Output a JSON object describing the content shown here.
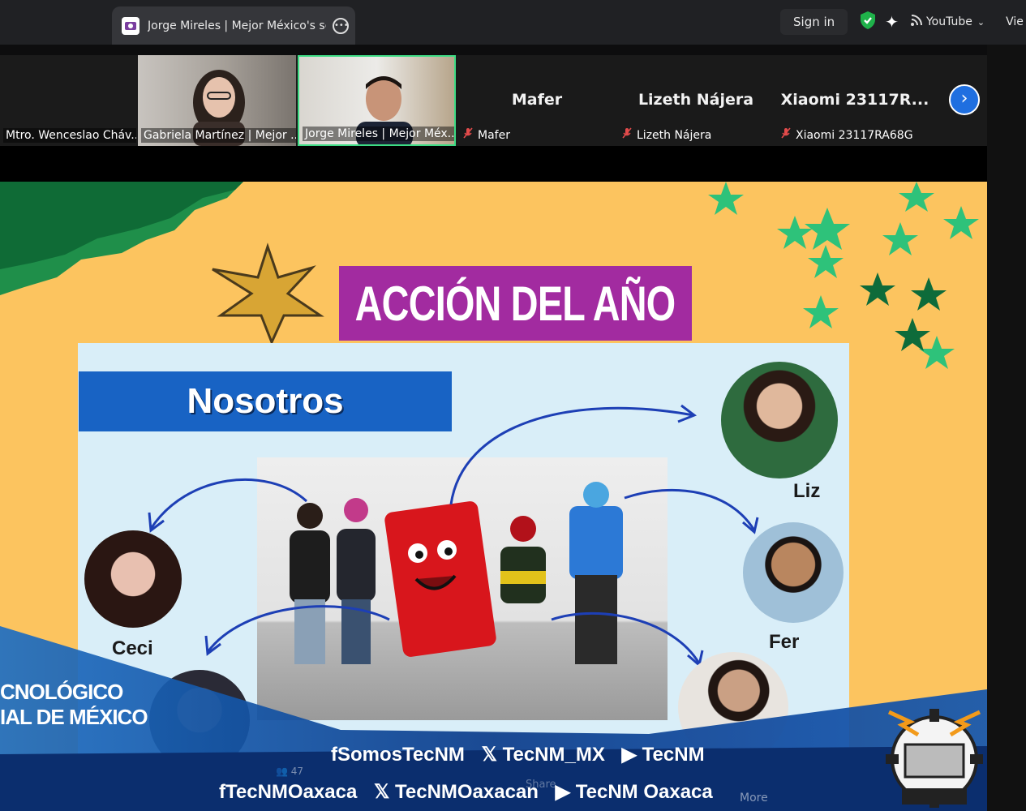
{
  "browser": {
    "tab_title": "Jorge Mireles | Mejor México's sc",
    "sign_in": "Sign in",
    "youtube_label": "YouTube",
    "view_label": "Vie",
    "icons": [
      "meeting-favicon",
      "tab-more-icon",
      "shield-check-icon",
      "sparkle-icon",
      "rss-icon",
      "chevron-down-icon"
    ]
  },
  "participants": [
    {
      "label": "Mtro. Wenceslao Cháv...",
      "type": "video"
    },
    {
      "label": "Gabriela Martínez | Mejor ...",
      "type": "video"
    },
    {
      "label": "Jorge Mireles | Mejor Méx...",
      "type": "video",
      "active_speaker": true
    },
    {
      "display": "Mafer",
      "label": "Mafer",
      "muted": true
    },
    {
      "display": "Lizeth Nájera",
      "label": "Lizeth Nájera",
      "muted": true
    },
    {
      "display": "Xiaomi 23117R...",
      "label": "Xiaomi 23117RA68G",
      "muted": true
    }
  ],
  "slide": {
    "title": "ACCIÓN DEL AÑO",
    "section": "Nosotros",
    "people": [
      "Liz",
      "Ceci",
      "Fer"
    ],
    "footer_left": [
      "CNOLÓGICO",
      "IAL DE MÉXICO"
    ],
    "social_row1": [
      "SomosTecNM",
      "TecNM_MX",
      "TecNM"
    ],
    "social_row2": [
      "TecNMOaxaca",
      "TecNMOaxacan",
      "TecNM Oaxaca"
    ]
  },
  "controls": {
    "participants_count": "47",
    "share_label": "Share",
    "more_label": "More"
  },
  "colors": {
    "slide_bg": "#fcc45f",
    "title_bg": "#a22ba0",
    "section_bg": "#1863c4",
    "active_tile_border": "#3ddc84",
    "next_button": "#1f6fe0"
  }
}
